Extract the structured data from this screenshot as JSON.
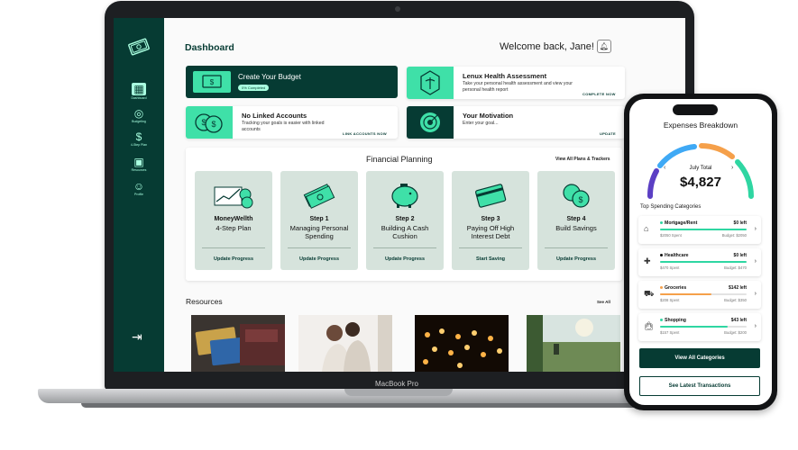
{
  "laptop": {
    "model_label": "MacBook Pro",
    "sidebar": {
      "items": [
        {
          "label": "Dashboard",
          "icon": "grid-icon"
        },
        {
          "label": "Budgeting",
          "icon": "budget-icon"
        },
        {
          "label": "4-Step Plan",
          "icon": "dollar-icon"
        },
        {
          "label": "Resources",
          "icon": "resources-icon"
        },
        {
          "label": "Profile",
          "icon": "profile-icon"
        }
      ],
      "logout_icon": "logout-icon"
    },
    "header": {
      "title": "Dashboard",
      "welcome": "Welcome back, Jane!",
      "bell_icon": "bell-icon"
    },
    "cards": {
      "budget": {
        "title": "Create Your Budget",
        "badge": "0% Completed",
        "action": "GET STARTED"
      },
      "health": {
        "title": "Lenux Health Assessment",
        "subtitle": "Take your personal health assessment and view your personal health report",
        "action": "COMPLETE NOW"
      },
      "accounts": {
        "title": "No Linked Accounts",
        "subtitle": "Tracking your goals is easier with linked accounts",
        "action": "LINK ACCOUNTS NOW"
      },
      "motivation": {
        "title": "Your Motivation",
        "subtitle": "Enter your goal...",
        "action": "UPDATE"
      }
    },
    "financial_planning": {
      "title": "Financial Planning",
      "link": "View All Plans & Trackers",
      "steps": [
        {
          "name": "MoneyWellth",
          "desc": "4-Step Plan",
          "action": "Update Progress"
        },
        {
          "name": "Step 1",
          "desc": "Managing Personal Spending",
          "action": "Update Progress"
        },
        {
          "name": "Step 2",
          "desc": "Building A Cash Cushion",
          "action": "Update Progress"
        },
        {
          "name": "Step 3",
          "desc": "Paying Off High Interest Debt",
          "action": "Start Saving"
        },
        {
          "name": "Step 4",
          "desc": "Build Savings",
          "action": "Update Progress"
        }
      ]
    },
    "resources": {
      "title": "Resources",
      "link": "See All"
    }
  },
  "phone": {
    "title": "Expenses Breakdown",
    "month": "July Total",
    "total": "$4,827",
    "section_title": "Top Spending Categories",
    "gauge_colors": [
      "#5b3fc4",
      "#3fa9f5",
      "#f5a04a",
      "#2fd6a2"
    ],
    "categories": [
      {
        "name": "Mortgage/Rent",
        "left": "$0 left",
        "spent": "$2050 Spent",
        "budget": "Budget: $2050",
        "progress": 1.0,
        "dot_color": "#2fd6a2",
        "icon": "house-icon"
      },
      {
        "name": "Healthcare",
        "left": "$0 left",
        "spent": "$470 Spent",
        "budget": "Budget: $470",
        "progress": 1.0,
        "dot_color": "#111111",
        "icon": "medical-icon"
      },
      {
        "name": "Groceries",
        "left": "$142 left",
        "spent": "$208 Spent",
        "budget": "Budget: $350",
        "progress": 0.59,
        "dot_color": "#f5a04a",
        "icon": "cart-icon"
      },
      {
        "name": "Shopping",
        "left": "$43 left",
        "spent": "$157 Spent",
        "budget": "Budget: $200",
        "progress": 0.78,
        "dot_color": "#2fd6a2",
        "icon": "bag-icon"
      }
    ],
    "btn_primary": "View All Categories",
    "btn_secondary": "See Latest Transactions"
  }
}
